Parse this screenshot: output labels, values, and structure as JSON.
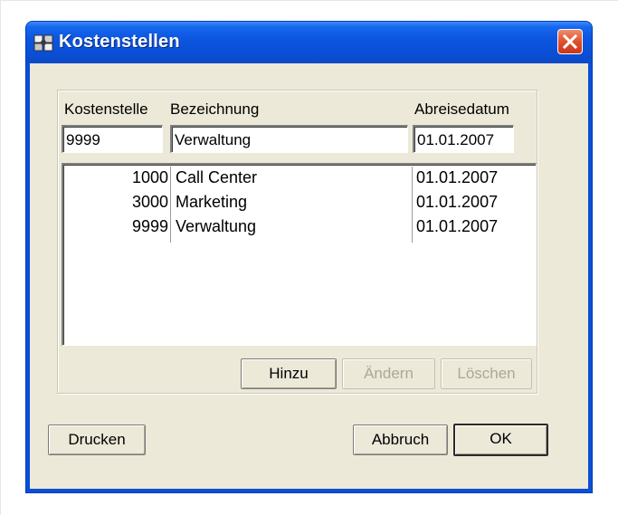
{
  "window": {
    "title": "Kostenstellen"
  },
  "labels": {
    "kostenstelle": "Kostenstelle",
    "bezeichnung": "Bezeichnung",
    "abreisedatum": "Abreisedatum"
  },
  "fields": {
    "kostenstelle_value": "9999",
    "bezeichnung_value": "Verwaltung",
    "abreisedatum_value": "01.01.2007"
  },
  "list": {
    "rows": [
      {
        "id": "1000",
        "name": "Call Center",
        "date": "01.01.2007"
      },
      {
        "id": "3000",
        "name": "Marketing",
        "date": "01.01.2007"
      },
      {
        "id": "9999",
        "name": "Verwaltung",
        "date": "01.01.2007"
      }
    ]
  },
  "buttons": {
    "hinzu": "Hinzu",
    "aendern": "Ändern",
    "loeschen": "Löschen",
    "drucken": "Drucken",
    "abbruch": "Abbruch",
    "ok": "OK"
  },
  "colors": {
    "titlebar": "#0a4fd6",
    "client": "#ece9d8",
    "close": "#e0502c"
  },
  "icons": {
    "app": "window-app-icon",
    "close": "close-icon"
  }
}
